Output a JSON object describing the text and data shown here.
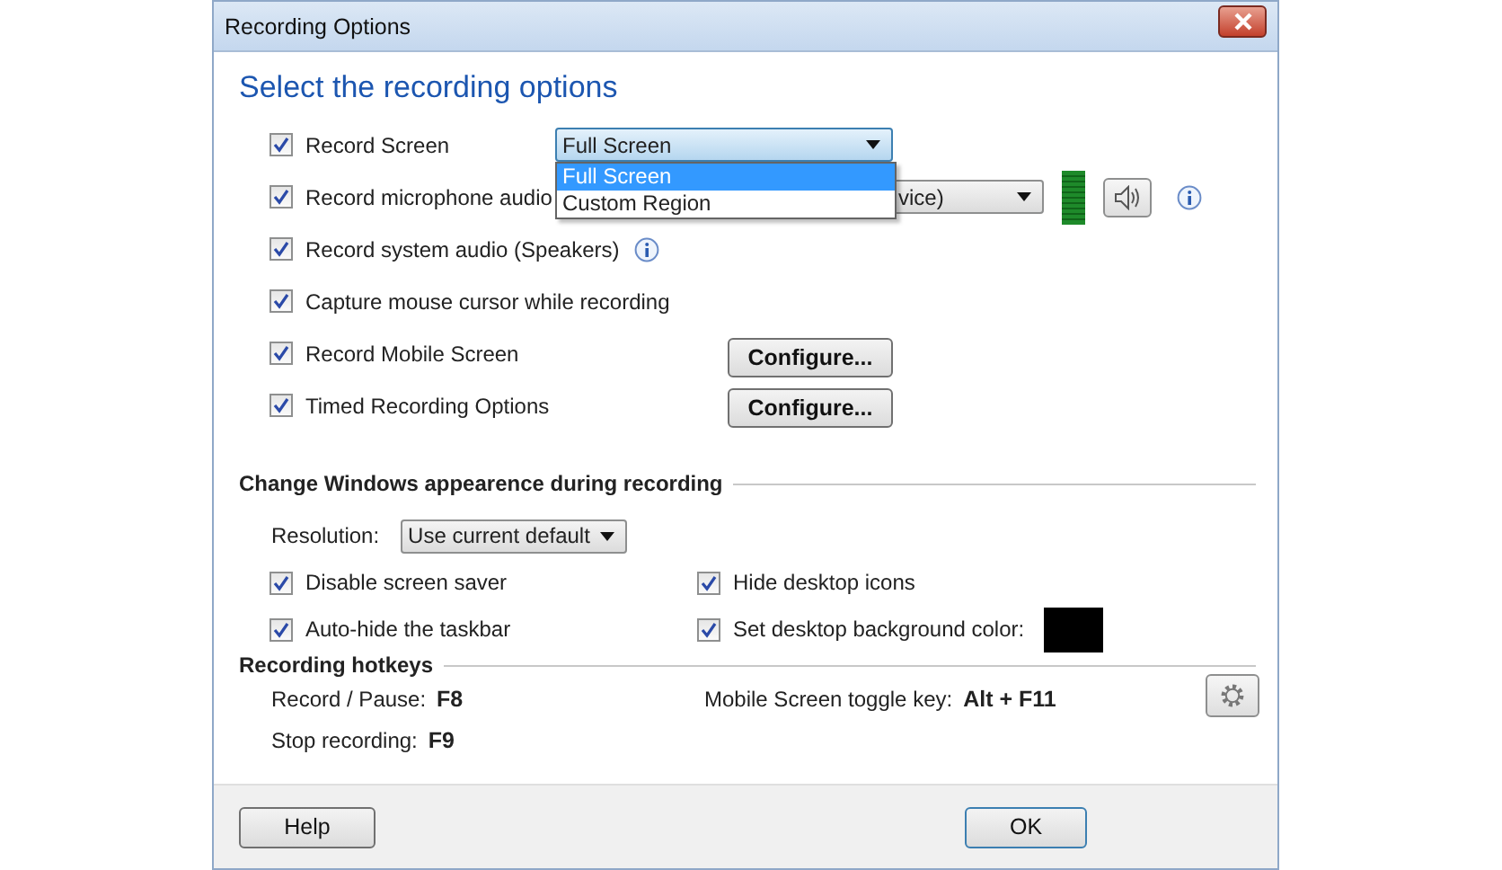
{
  "window": {
    "title": "Recording Options"
  },
  "heading": "Select the recording options",
  "options": [
    {
      "kind": "select",
      "label": "Record Screen",
      "checked": true,
      "value": "Full Screen",
      "dropdown": [
        {
          "label": "Full Screen",
          "selected": true
        },
        {
          "label": "Custom Region",
          "selected": false
        }
      ]
    },
    {
      "kind": "audio",
      "label": "Record microphone audio",
      "checked": true,
      "device": "vice)"
    },
    {
      "kind": "info",
      "label": "Record system audio (Speakers)",
      "checked": true
    },
    {
      "kind": "plain",
      "label": "Capture mouse cursor while recording",
      "checked": true
    },
    {
      "kind": "button",
      "label": "Record Mobile Screen",
      "checked": true,
      "button": "Configure..."
    },
    {
      "kind": "button",
      "label": "Timed Recording Options",
      "checked": true,
      "button": "Configure..."
    }
  ],
  "appearance": {
    "title": "Change Windows appearence during recording",
    "resolution_label": "Resolution:",
    "resolution": "Use current default",
    "options": [
      {
        "kind": "plain",
        "label": "Disable screen saver",
        "checked": true
      },
      {
        "kind": "plain",
        "label": "Hide desktop icons",
        "checked": true
      },
      {
        "kind": "plain",
        "label": "Auto-hide the taskbar",
        "checked": true
      },
      {
        "kind": "color",
        "label": "Set desktop background color:",
        "checked": true,
        "color": "#000000"
      }
    ]
  },
  "hotkeys": {
    "title": "Recording hotkeys",
    "items": [
      {
        "label": "Record / Pause:",
        "key": "F8"
      },
      {
        "label": "Mobile Screen toggle key:",
        "key": "Alt + F11"
      },
      {
        "label": "Stop recording:",
        "key": "F9"
      }
    ]
  },
  "buttons": [
    "Help",
    "OK"
  ]
}
